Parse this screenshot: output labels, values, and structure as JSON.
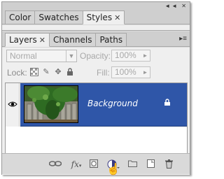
{
  "panel_controls": "◄◄ ✕",
  "group1": {
    "tabs": [
      {
        "label": "Color",
        "active": false
      },
      {
        "label": "Swatches",
        "active": false
      },
      {
        "label": "Styles",
        "active": true,
        "close": "✕"
      }
    ]
  },
  "group2": {
    "tabs": [
      {
        "label": "Layers",
        "active": true,
        "close": "✕"
      },
      {
        "label": "Channels",
        "active": false
      },
      {
        "label": "Paths",
        "active": false
      }
    ],
    "menu_glyph": "▸≡"
  },
  "layers": {
    "blend_mode": "Normal",
    "opacity_label": "Opacity:",
    "opacity_value": "100%",
    "lock_label": "Lock:",
    "fill_label": "Fill:",
    "fill_value": "100%",
    "rows": [
      {
        "name": "Background",
        "visible": true,
        "locked": true,
        "selected": true
      }
    ]
  },
  "bottom_bar": {
    "icons": [
      "link-layers-icon",
      "layer-style-icon",
      "layer-mask-icon",
      "adjustment-layer-icon",
      "new-group-icon",
      "new-layer-icon",
      "delete-layer-icon"
    ],
    "fx_label": "fx"
  },
  "colors": {
    "selection": "#2f56a8",
    "panel_bg": "#efefef",
    "tab_bg": "#cfcfcf"
  }
}
